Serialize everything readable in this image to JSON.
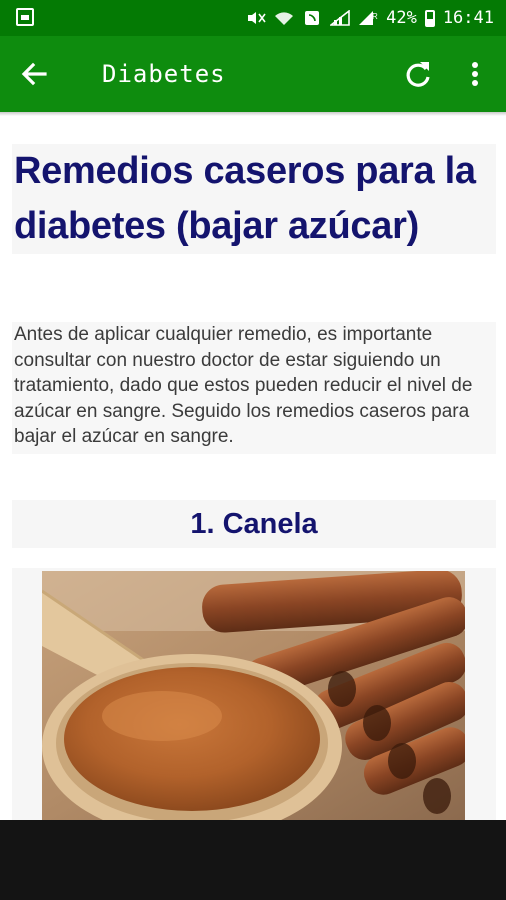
{
  "status_bar": {
    "battery": "42%",
    "time": "16:41",
    "icons": [
      "notification-icon",
      "mute-icon",
      "wifi-icon",
      "nfc-icon",
      "signal-icon",
      "signal-r-icon",
      "battery-icon"
    ]
  },
  "app_bar": {
    "title": "Diabetes",
    "actions": [
      "back-arrow-icon",
      "refresh-icon",
      "more-vert-icon"
    ],
    "color": "#0e8c0e",
    "status_color": "#047a04"
  },
  "article": {
    "title": "Remedios caseros para la diabetes (bajar azúcar)",
    "intro": "Antes de aplicar cualquier remedio, es importante consultar con nuestro doctor de estar siguiendo un tratamiento, dado que estos pueden reducir el nivel de azúcar en sangre. Seguido los remedios caseros para bajar el azúcar en sangre.",
    "sections": [
      {
        "heading": "1. Canela"
      }
    ],
    "title_color": "#14146e"
  }
}
